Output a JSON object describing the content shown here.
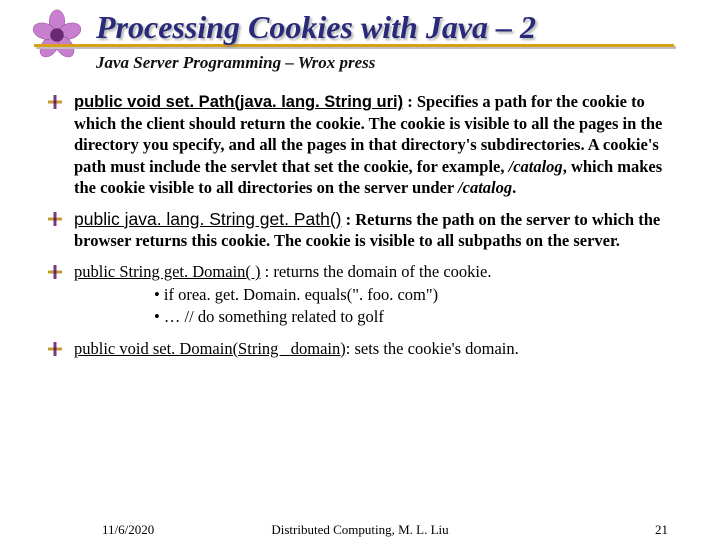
{
  "title": "Processing Cookies with Java – 2",
  "subtitle": "Java Server Programming – Wrox press",
  "bullets": [
    {
      "sig": "public void set. Path(java. lang. String uri)",
      "desc": " : Specifies a path for the cookie to which the client should return the cookie. The cookie is visible to all the pages in the directory you specify, and all the pages in that directory's subdirectories. A cookie's path must include the servlet that set the cookie, for example, ",
      "ital": "/catalog",
      "desc2": ", which makes the cookie visible to all directories on the server under ",
      "ital2": "/catalog",
      "desc3": "."
    },
    {
      "sig": "public java. lang. String get. Path()",
      "desc": " : Returns the path on the server to which the browser returns this cookie. The cookie is visible to all subpaths on the server."
    },
    {
      "sig": "public String get. Domain( )",
      "desc": " : returns the domain of the cookie.",
      "sub": [
        "if orea. get. Domain. equals(\". foo. com\")",
        "       …  // do something related to golf"
      ]
    },
    {
      "sig": "public void set. Domain(String _domain)",
      "desc": ": sets the cookie's domain."
    }
  ],
  "footer": {
    "date": "11/6/2020",
    "center": "Distributed Computing, M. L. Liu",
    "page": "21"
  }
}
